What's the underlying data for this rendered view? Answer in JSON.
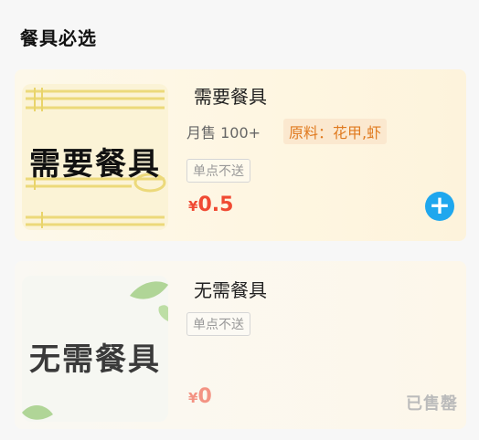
{
  "section": {
    "title": "餐具必选"
  },
  "items": [
    {
      "thumb_text": "需要餐具",
      "name": "需要餐具",
      "sales": "月售 100+",
      "ingredients": "原料：花甲,虾",
      "tag": "单点不送",
      "price_symbol": "¥",
      "price_value": "0.5",
      "add_label": "+"
    },
    {
      "thumb_text": "无需餐具",
      "name": "无需餐具",
      "tag": "单点不送",
      "price_symbol": "¥",
      "price_value": "0",
      "status": "已售罄"
    }
  ],
  "colors": {
    "price": "#f04a33",
    "add_button": "#1fa7ee",
    "ingredient_text": "#e07a1f",
    "soldout_text": "#bbbbbb"
  }
}
